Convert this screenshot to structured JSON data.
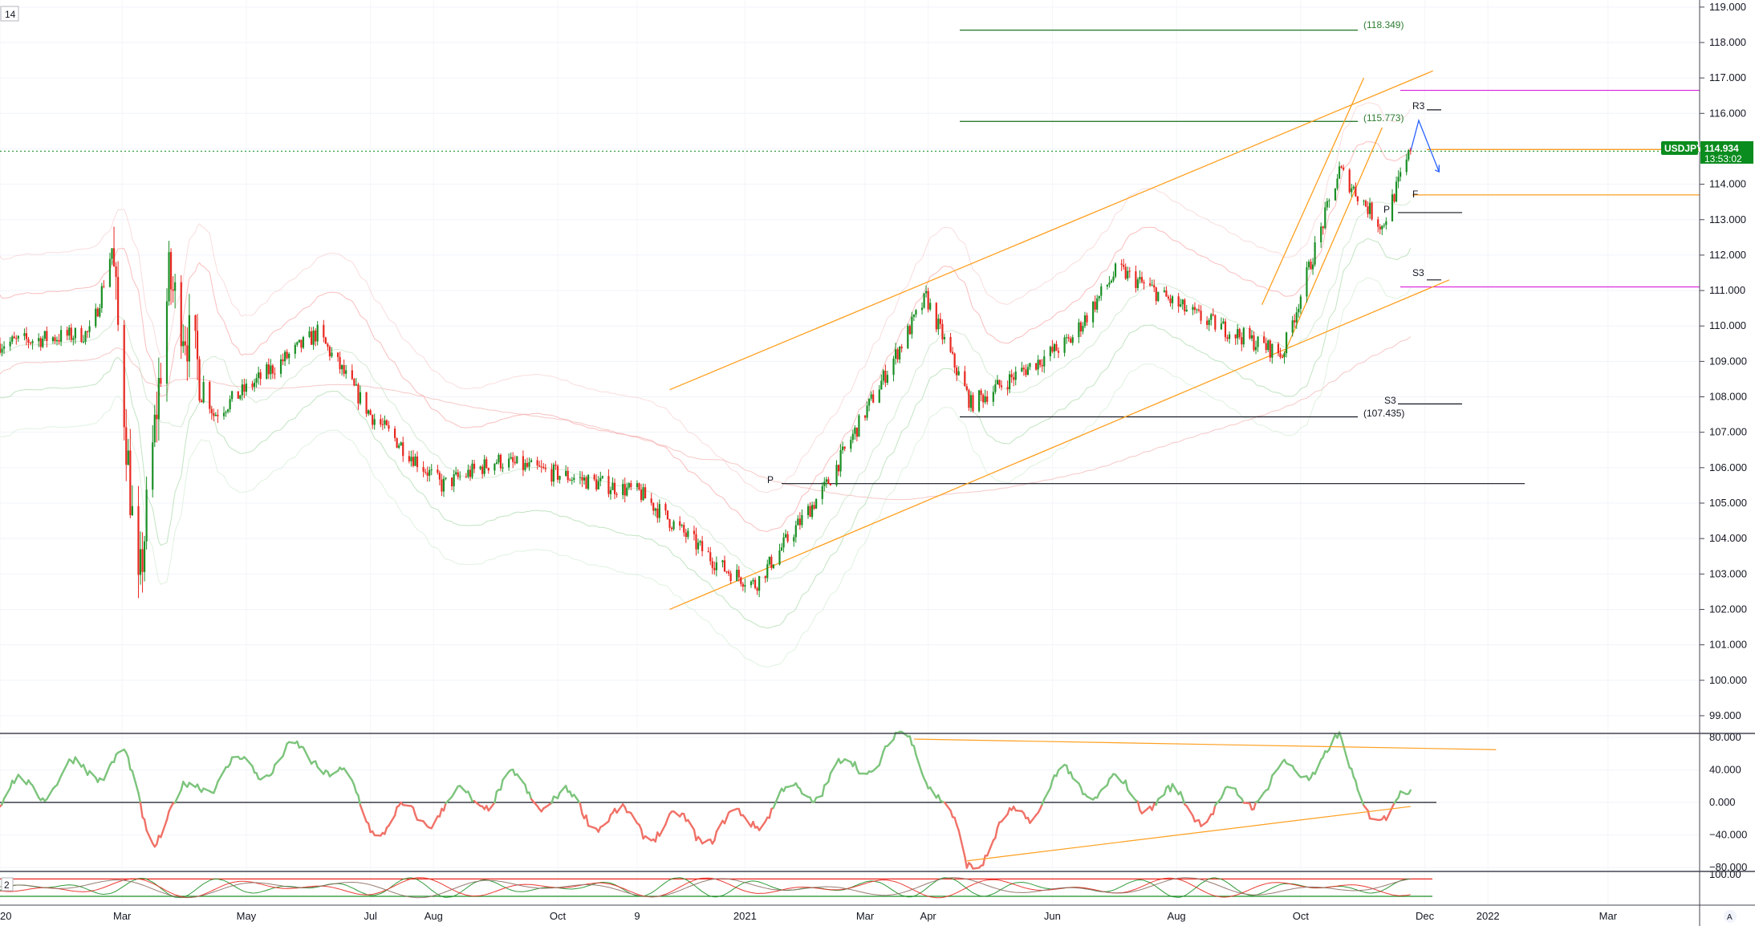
{
  "interval_badge": "14",
  "symbol": "USDJPY",
  "last_price": "114.934",
  "countdown": "13:53:02",
  "levels": {
    "upper_target": "(118.349)",
    "mid_target": "(115.773)",
    "lower_target": "(107.435)",
    "r3": "R3",
    "s3_upper": "S3",
    "s3_lower": "S3",
    "pivot_left": "P",
    "pivot_right": "P",
    "f_marker": "F"
  },
  "colors": {
    "up": "#1a8f24",
    "down": "#e8271f",
    "channel": "#ff9f1f",
    "target": "#2e7d32",
    "magenta": "#d500d5",
    "projection": "#2962ff",
    "osc_up": "#7cc47c",
    "osc_down": "#f07167",
    "price_tag": "#0b8c1e"
  },
  "price_axis": [
    "119.000",
    "118.000",
    "117.000",
    "116.000",
    "115.000",
    "114.000",
    "113.000",
    "112.000",
    "111.000",
    "110.000",
    "109.000",
    "108.000",
    "107.000",
    "106.000",
    "105.000",
    "104.000",
    "103.000",
    "102.000",
    "101.000",
    "100.000",
    "99.000"
  ],
  "osc_axis": [
    "80.000",
    "40.000",
    "0.000",
    "−40.000",
    "−80.000"
  ],
  "rsi_axis": "100.00",
  "rsi_badge": "2",
  "time_axis": [
    "2020",
    "Mar",
    "May",
    "Jul",
    "Aug",
    "Oct",
    "9",
    "2021",
    "Mar",
    "Apr",
    "Jun",
    "Aug",
    "Oct",
    "Dec",
    "2022",
    "Mar"
  ],
  "footer_icon": "A",
  "chart_data": {
    "type": "candlestick",
    "title": "",
    "symbol": "USDJPY",
    "ylim": [
      98.5,
      119.2
    ],
    "x_range": [
      "2020-01-01",
      "2022-04-15"
    ],
    "checkpoints": [
      {
        "date": "2020-01-01",
        "close": 109.5
      },
      {
        "date": "2020-02-15",
        "close": 109.8
      },
      {
        "date": "2020-02-25",
        "close": 112.2
      },
      {
        "date": "2020-03-09",
        "close": 102.3
      },
      {
        "date": "2020-03-24",
        "close": 111.3
      },
      {
        "date": "2020-04-15",
        "close": 107.5
      },
      {
        "date": "2020-06-05",
        "close": 109.8
      },
      {
        "date": "2020-07-01",
        "close": 107.5
      },
      {
        "date": "2020-08-05",
        "close": 105.5
      },
      {
        "date": "2020-09-01",
        "close": 106.2
      },
      {
        "date": "2020-11-10",
        "close": 105.3
      },
      {
        "date": "2020-12-20",
        "close": 103.2
      },
      {
        "date": "2021-01-06",
        "close": 102.7
      },
      {
        "date": "2021-02-10",
        "close": 105.5
      },
      {
        "date": "2021-03-31",
        "close": 110.8
      },
      {
        "date": "2021-04-22",
        "close": 107.8
      },
      {
        "date": "2021-06-10",
        "close": 109.6
      },
      {
        "date": "2021-07-03",
        "close": 111.6
      },
      {
        "date": "2021-08-10",
        "close": 110.3
      },
      {
        "date": "2021-09-22",
        "close": 109.2
      },
      {
        "date": "2021-10-20",
        "close": 114.4
      },
      {
        "date": "2021-11-10",
        "close": 112.8
      },
      {
        "date": "2021-11-24",
        "close": 114.93
      }
    ],
    "last": 114.934,
    "horizontal_levels": [
      {
        "label": "(118.349)",
        "value": 118.349
      },
      {
        "label": "(115.773)",
        "value": 115.773
      },
      {
        "label": "(107.435)",
        "value": 107.435
      },
      {
        "label": "R3",
        "value": 116.1
      },
      {
        "label": "S3",
        "value": 111.3
      },
      {
        "label": "S3",
        "value": 107.8
      },
      {
        "label": "P",
        "value": 105.55
      },
      {
        "label": "P",
        "value": 113.2
      }
    ],
    "oscillator": {
      "ylim": [
        -85,
        85
      ],
      "ticks": [
        80,
        40,
        0,
        -40,
        -80
      ],
      "checkpoints": [
        {
          "date": "2020-01-01",
          "v": 5
        },
        {
          "date": "2020-03-01",
          "v": 55
        },
        {
          "date": "2020-03-15",
          "v": -40
        },
        {
          "date": "2020-04-10",
          "v": 30
        },
        {
          "date": "2020-06-05",
          "v": 62
        },
        {
          "date": "2020-07-05",
          "v": -30
        },
        {
          "date": "2020-09-10",
          "v": 20
        },
        {
          "date": "2020-11-01",
          "v": -25
        },
        {
          "date": "2020-12-20",
          "v": -35
        },
        {
          "date": "2021-03-25",
          "v": 78
        },
        {
          "date": "2021-04-20",
          "v": -75
        },
        {
          "date": "2021-06-05",
          "v": 28
        },
        {
          "date": "2021-08-20",
          "v": -10
        },
        {
          "date": "2021-10-20",
          "v": 65
        },
        {
          "date": "2021-11-12",
          "v": -35
        },
        {
          "date": "2021-11-24",
          "v": 25
        }
      ]
    },
    "rsi_pane": {
      "tick": 100.0
    }
  }
}
